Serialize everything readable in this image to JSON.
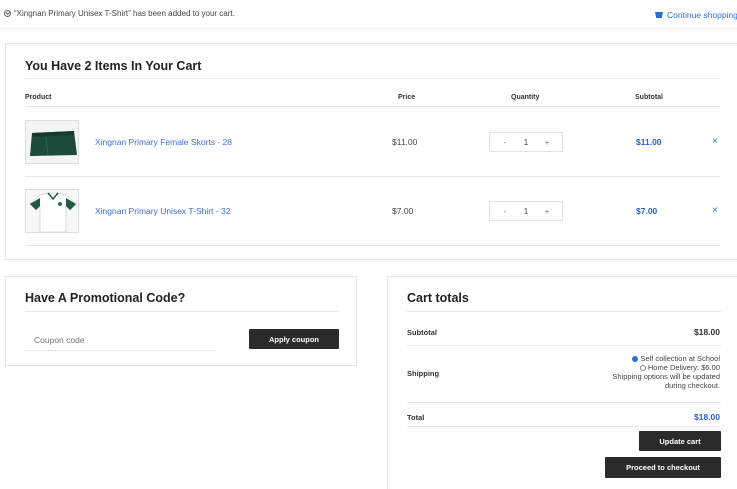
{
  "notice": {
    "text": "“Xingnan Primary Unisex T-Shirt” has been added to your cart."
  },
  "continue_link": {
    "label": "Continue shopping"
  },
  "cart": {
    "title": "You Have 2 Items In Your Cart",
    "columns": [
      "Product",
      "Price",
      "Quantity",
      "Subtotal"
    ],
    "items": [
      {
        "name": "Xingnan Primary Female Skorts - 28",
        "price": "$11.00",
        "quantity": "1",
        "subtotal": "$11.00",
        "remove": "×"
      },
      {
        "name": "Xingnan Primary Unisex T-Shirt - 32",
        "price": "$7.00",
        "quantity": "1",
        "subtotal": "$7.00",
        "remove": "×"
      }
    ],
    "qty_minus": "-",
    "qty_plus": "+"
  },
  "promo": {
    "title": "Have A Promotional Code?",
    "placeholder": "Coupon code",
    "apply_label": "Apply coupon"
  },
  "totals": {
    "title": "Cart totals",
    "subtotal_label": "Subtotal",
    "subtotal_value": "$18.00",
    "shipping_label": "Shipping",
    "shipping_option_1": "Self collection at School",
    "shipping_option_2": "Home Delivery: $6.00",
    "shipping_note_1": "Shipping options will be updated",
    "shipping_note_2": "during checkout.",
    "total_label": "Total",
    "total_value": "$18.00",
    "update_label": "Update cart",
    "checkout_label": "Proceed to checkout"
  },
  "colors": {
    "link": "#3a6fd0",
    "accent": "#2a62cc",
    "button": "#2b2b2b"
  }
}
